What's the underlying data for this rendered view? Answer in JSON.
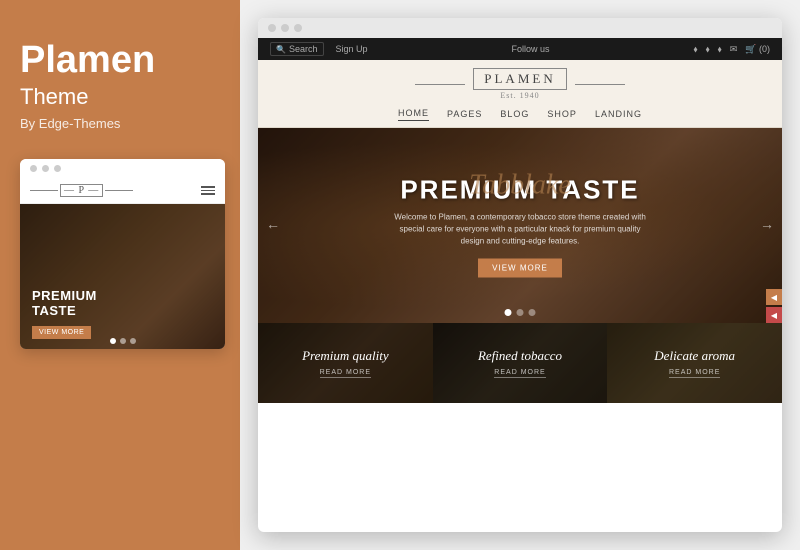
{
  "left": {
    "brand": "Plamen",
    "subtitle": "Theme",
    "author": "By Edge-Themes",
    "mini_preview": {
      "logo": "P",
      "hero_text_line1": "PREMIUM",
      "hero_text_line2": "TASTE",
      "btn_label": "VIEW MORE",
      "dots": [
        true,
        false,
        false
      ]
    }
  },
  "right": {
    "browser": {
      "topbar": {
        "search_placeholder": "Search",
        "signin": "Sign Up",
        "follow_us": "Follow us",
        "icons": [
          "envelope",
          "cart"
        ],
        "cart_count": "0"
      },
      "header": {
        "logo": "PLAMEN",
        "logo_sub": "Est. 1940",
        "nav_items": [
          "HOME",
          "PAGES",
          "BLOG",
          "SHOP",
          "LANDING"
        ],
        "active_nav": "HOME"
      },
      "hero": {
        "italic_text": "Tabblake",
        "title": "PREMIUM TASTE",
        "description": "Welcome to Plamen, a contemporary tobacco store theme created with special care for everyone with a particular knack for premium quality design and cutting-edge features.",
        "btn_label": "VIEW MORE",
        "dots": [
          true,
          false,
          false
        ]
      },
      "cards": [
        {
          "title": "Premium quality",
          "link": "READ MORE"
        },
        {
          "title": "Refined tobacco",
          "link": "READ MORE"
        },
        {
          "title": "Delicate aroma",
          "link": "READ MORE"
        }
      ]
    }
  }
}
